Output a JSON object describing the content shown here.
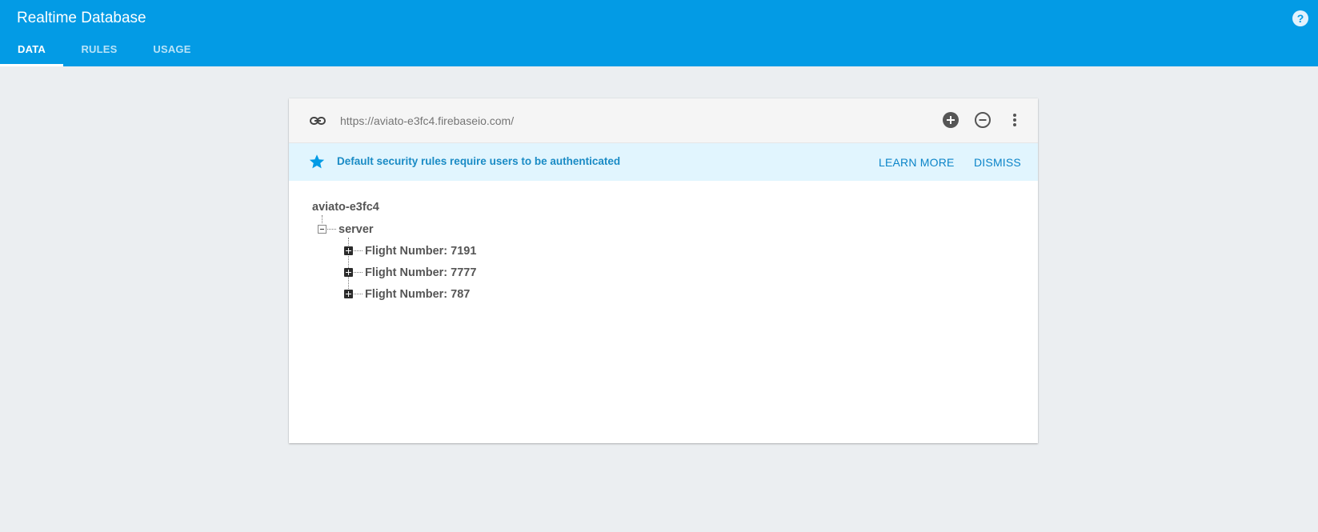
{
  "header": {
    "title": "Realtime Database",
    "tabs": [
      "DATA",
      "RULES",
      "USAGE"
    ]
  },
  "url_bar": {
    "url": "https://aviato-e3fc4.firebaseio.com/"
  },
  "banner": {
    "message": "Default security rules require users to be authenticated",
    "learn_more": "LEARN MORE",
    "dismiss": "DISMISS"
  },
  "tree": {
    "root": "aviato-e3fc4",
    "server": "server",
    "children": [
      "Flight Number: 7191",
      "Flight Number: 7777",
      "Flight Number: 787"
    ]
  },
  "colors": {
    "header": "#039be5",
    "background": "#ebeef1",
    "banner": "#e1f5fe",
    "banner_text": "#1a8bc5"
  }
}
